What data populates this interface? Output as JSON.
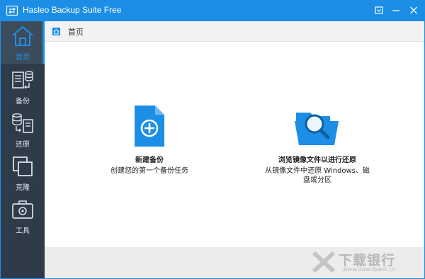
{
  "window": {
    "title": "Hasleo Backup Suite Free",
    "accent_color": "#1c8ee6",
    "sidebar_color": "#2f3b49"
  },
  "titlebar_buttons": [
    {
      "icon": "window-menu-icon"
    },
    {
      "icon": "minimize-icon"
    },
    {
      "icon": "close-icon"
    }
  ],
  "sidebar": {
    "items": [
      {
        "label": "首页",
        "icon": "home-icon",
        "active": true
      },
      {
        "label": "备份",
        "icon": "backup-icon",
        "active": false
      },
      {
        "label": "还原",
        "icon": "restore-icon",
        "active": false
      },
      {
        "label": "克隆",
        "icon": "clone-icon",
        "active": false
      },
      {
        "label": "工具",
        "icon": "toolbox-icon",
        "active": false
      }
    ]
  },
  "breadcrumb": {
    "icon": "home-small-icon",
    "label": "首页"
  },
  "actions": [
    {
      "title": "新建备份",
      "description": "创建您的第一个备份任务",
      "icon": "new-backup-document-plus-icon"
    },
    {
      "title": "浏览镜像文件以进行还原",
      "description": "从镜像文件中还原 Windows、磁盘或分区",
      "icon": "folder-search-icon"
    }
  ],
  "watermark": {
    "text": "下载银行",
    "url": "www.downbank.cn"
  }
}
